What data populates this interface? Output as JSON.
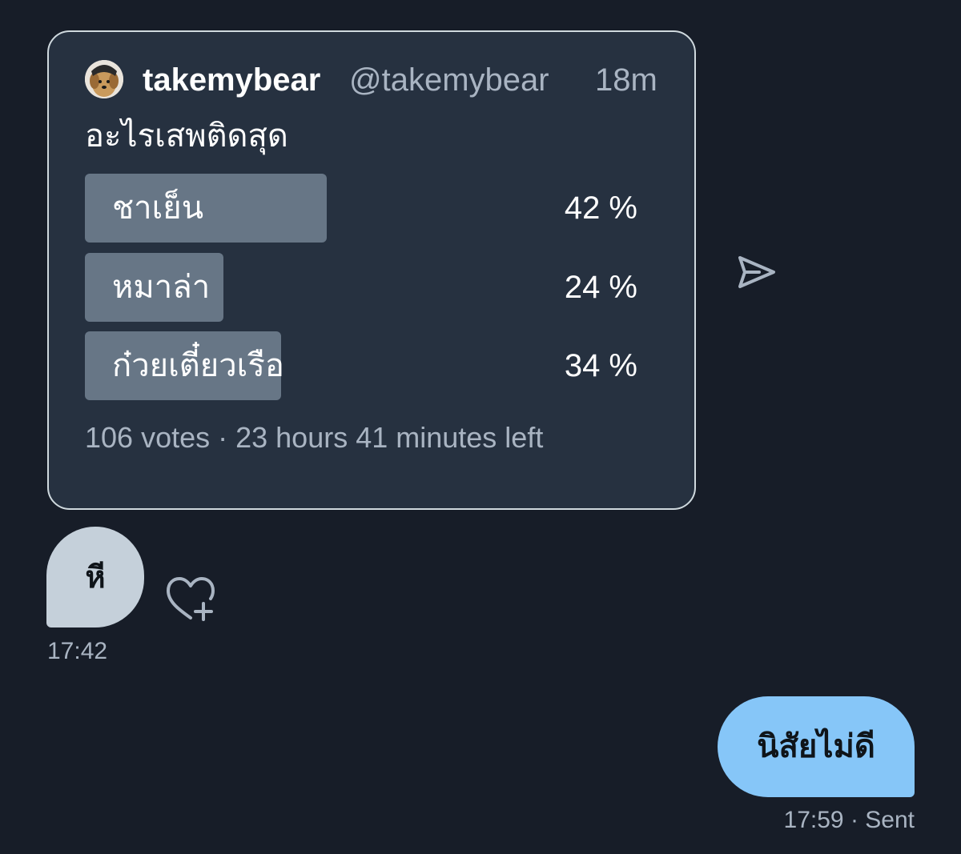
{
  "quoted_tweet": {
    "display_name": "takemybear",
    "handle": "@takemybear",
    "time_ago": "18m",
    "text": "อะไรเสพติดสุด",
    "poll": {
      "options": [
        {
          "label": "ชาเย็น",
          "percent_text": "42 %",
          "share": 0.42
        },
        {
          "label": "หมาล่า",
          "percent_text": "24 %",
          "share": 0.24
        },
        {
          "label": "ก๋วยเตี๋ยวเรือ",
          "percent_text": "34 %",
          "share": 0.34
        }
      ],
      "meta": "106 votes · 23 hours 41 minutes left"
    }
  },
  "received_message": {
    "text": "หี",
    "time": "17:42"
  },
  "sent_message": {
    "text": "นิสัยไม่ดี",
    "status": "17:59 · Sent"
  },
  "icons": {
    "share": "send-icon",
    "react": "heart-plus-icon",
    "avatar": "dog-avatar"
  },
  "colors": {
    "background": "#171d28",
    "card": "#263140",
    "poll_bar": "#677686",
    "received_bubble": "#c5d0da",
    "sent_bubble": "#86c6f8",
    "muted_text": "#a9b4c2"
  }
}
